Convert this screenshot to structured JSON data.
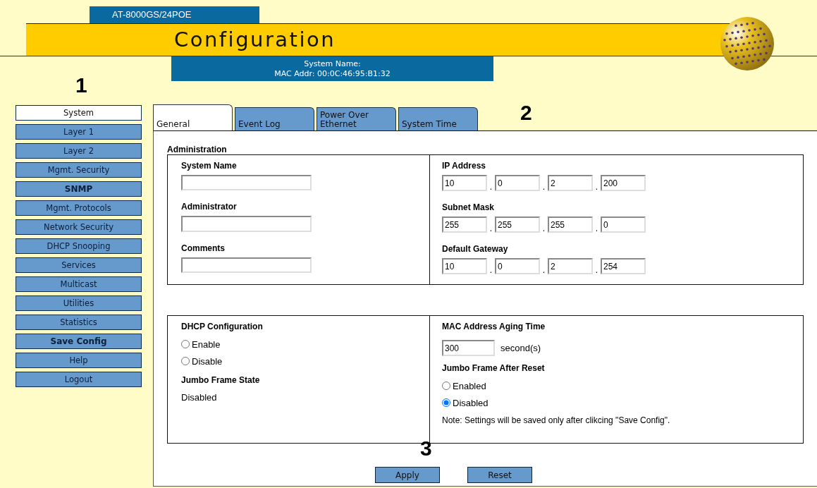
{
  "header": {
    "model": "AT-8000GS/24POE",
    "title": "Configuration",
    "system_name": "System Name:",
    "mac_address": "MAC Addr: 00:0C:46:95:B1:32"
  },
  "callouts": [
    "1",
    "2",
    "3"
  ],
  "sidebar": {
    "items": [
      {
        "label": "System",
        "selected": true,
        "bold": false
      },
      {
        "label": "Layer 1",
        "selected": false,
        "bold": false
      },
      {
        "label": "Layer 2",
        "selected": false,
        "bold": false
      },
      {
        "label": "Mgmt. Security",
        "selected": false,
        "bold": false
      },
      {
        "label": "SNMP",
        "selected": false,
        "bold": true
      },
      {
        "label": "Mgmt. Protocols",
        "selected": false,
        "bold": false
      },
      {
        "label": "Network Security",
        "selected": false,
        "bold": false
      },
      {
        "label": "DHCP Snooping",
        "selected": false,
        "bold": false
      },
      {
        "label": "Services",
        "selected": false,
        "bold": false
      },
      {
        "label": "Multicast",
        "selected": false,
        "bold": false
      },
      {
        "label": "Utilities",
        "selected": false,
        "bold": false
      },
      {
        "label": "Statistics",
        "selected": false,
        "bold": false
      },
      {
        "label": "Save Config",
        "selected": false,
        "bold": true
      },
      {
        "label": "Help",
        "selected": false,
        "bold": false
      },
      {
        "label": "Logout",
        "selected": false,
        "bold": false
      }
    ]
  },
  "tabs": [
    {
      "label": "General",
      "selected": true
    },
    {
      "label": "Event Log",
      "selected": false
    },
    {
      "label": "Power Over Ethernet",
      "selected": false
    },
    {
      "label": "System Time",
      "selected": false
    }
  ],
  "administration": {
    "title": "Administration",
    "fields": [
      {
        "label": "System Name"
      },
      {
        "label": "Administrator"
      },
      {
        "label": "Comments"
      }
    ],
    "addresses": [
      {
        "label": "IP Address",
        "octets": [
          "10",
          "0",
          "2",
          "200"
        ],
        "separators": [
          ".",
          ".",
          "."
        ]
      },
      {
        "label": "Subnet Mask",
        "octets": [
          "255",
          "255",
          "255",
          "0"
        ],
        "separators": [
          ".",
          ".",
          "."
        ]
      },
      {
        "label": "Default Gateway",
        "octets": [
          "10",
          "0",
          "2",
          "254"
        ],
        "separators": [
          ".",
          ".",
          "."
        ]
      }
    ]
  },
  "dhcp": {
    "title": "DHCP Configuration",
    "options": [
      {
        "label": "Enable",
        "selected": false
      },
      {
        "label": "Disable",
        "selected": false
      }
    ]
  },
  "jumbo_state": {
    "title": "Jumbo Frame State",
    "value": "Disabled"
  },
  "mac_aging": {
    "title": "MAC Address Aging Time",
    "value": "300",
    "unit": "second(s)"
  },
  "jumbo_after_reset": {
    "title": "Jumbo Frame After Reset",
    "options": [
      {
        "label": "Enabled",
        "selected": false
      },
      {
        "label": "Disabled",
        "selected": true
      }
    ]
  },
  "note": "Note: Settings will be saved only after clikcing \"Save Config\".",
  "buttons": [
    "Apply",
    "Reset"
  ]
}
